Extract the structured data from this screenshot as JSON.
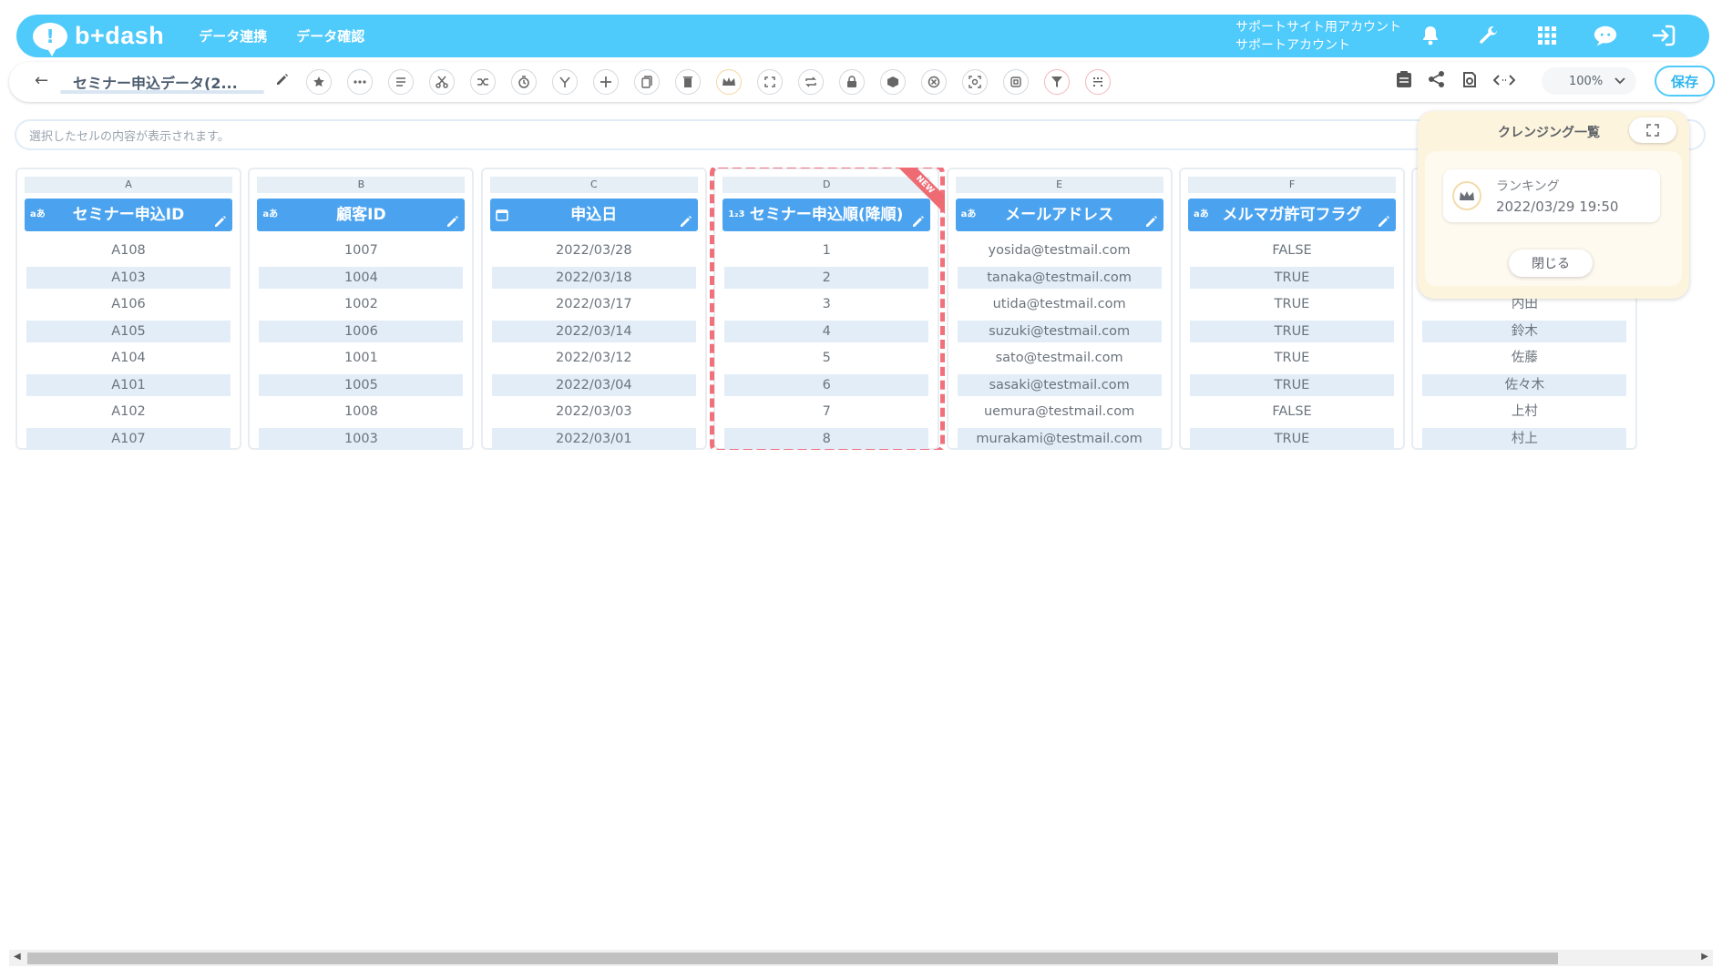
{
  "header": {
    "logo_text": "b+dash",
    "nav": [
      "データ連携",
      "データ確認"
    ],
    "account_line1": "サポートサイト用アカウント",
    "account_line2": "サポートアカウント"
  },
  "toolbar": {
    "sheet_title": "セミナー申込データ(2...",
    "zoom_value": "100%",
    "save_label": "保存"
  },
  "cellbar": {
    "placeholder": "選択したセルの内容が表示されます。"
  },
  "grid": {
    "columns": [
      {
        "letter": "A",
        "header": "セミナー申込ID",
        "type": "aあ",
        "cells": [
          "A108",
          "A103",
          "A106",
          "A105",
          "A104",
          "A101",
          "A102",
          "A107"
        ]
      },
      {
        "letter": "B",
        "header": "顧客ID",
        "type": "aあ",
        "cells": [
          "1007",
          "1004",
          "1002",
          "1006",
          "1001",
          "1005",
          "1008",
          "1003"
        ]
      },
      {
        "letter": "C",
        "header": "申込日",
        "type": "calendar",
        "cells": [
          "2022/03/28",
          "2022/03/18",
          "2022/03/17",
          "2022/03/14",
          "2022/03/12",
          "2022/03/04",
          "2022/03/03",
          "2022/03/01"
        ]
      },
      {
        "letter": "D",
        "header": "セミナー申込順(降順)",
        "type": "1₂3",
        "cells": [
          "1",
          "2",
          "3",
          "4",
          "5",
          "6",
          "7",
          "8"
        ],
        "badge": "NEW"
      },
      {
        "letter": "E",
        "header": "メールアドレス",
        "type": "aあ",
        "cells": [
          "yosida@testmail.com",
          "tanaka@testmail.com",
          "utida@testmail.com",
          "suzuki@testmail.com",
          "sato@testmail.com",
          "sasaki@testmail.com",
          "uemura@testmail.com",
          "murakami@testmail.com"
        ]
      },
      {
        "letter": "F",
        "header": "メルマガ許可フラグ",
        "type": "aあ",
        "cells": [
          "FALSE",
          "TRUE",
          "TRUE",
          "TRUE",
          "TRUE",
          "TRUE",
          "FALSE",
          "TRUE"
        ]
      },
      {
        "letter": "",
        "header": "",
        "type": "",
        "cells": [
          "",
          "",
          "内田",
          "鈴木",
          "佐藤",
          "佐々木",
          "上村",
          "村上"
        ]
      }
    ]
  },
  "popup": {
    "title": "クレンジング一覧",
    "item_name": "ランキング",
    "item_date": "2022/03/29 19:50",
    "close_label": "閉じる"
  },
  "colors": {
    "header_bg": "#4ecafb",
    "column_header": "#4ba3ef",
    "highlight": "#f0707c",
    "popup_bg": "#fdf4dd"
  }
}
